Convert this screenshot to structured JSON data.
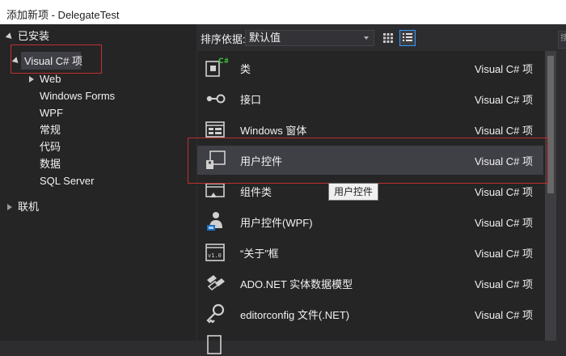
{
  "window": {
    "title": "添加新项 - DelegateTest"
  },
  "tree": {
    "installed": "已安装",
    "visual_csharp": "Visual C# 项",
    "children": [
      "Web",
      "Windows Forms",
      "WPF",
      "常规",
      "代码",
      "数据",
      "SQL Server"
    ],
    "online": "联机"
  },
  "toolbar": {
    "sort_label": "排序依据:",
    "sort_value": "默认值",
    "search_placeholder": "搜"
  },
  "items": [
    {
      "name": "类",
      "category": "Visual C# 项",
      "icon": "class-icon"
    },
    {
      "name": "接口",
      "category": "Visual C# 项",
      "icon": "interface-icon"
    },
    {
      "name": "Windows 窗体",
      "category": "Visual C# 项",
      "icon": "windows-form-icon"
    },
    {
      "name": "用户控件",
      "category": "Visual C# 项",
      "icon": "user-control-icon"
    },
    {
      "name": "组件类",
      "category": "Visual C# 项",
      "icon": "component-class-icon"
    },
    {
      "name": "用户控件(WPF)",
      "category": "Visual C# 项",
      "icon": "wpf-user-control-icon"
    },
    {
      "name": "“关于”框",
      "category": "Visual C# 项",
      "icon": "about-box-icon"
    },
    {
      "name": "ADO.NET 实体数据模型",
      "category": "Visual C# 项",
      "icon": "entity-model-icon"
    },
    {
      "name": "editorconfig 文件(.NET)",
      "category": "Visual C# 项",
      "icon": "editorconfig-icon"
    }
  ],
  "tooltip": "用户控件",
  "colors": {
    "accent": "#3399ff",
    "highlight_box": "#c0302e",
    "selected_row": "#3f3f46"
  }
}
